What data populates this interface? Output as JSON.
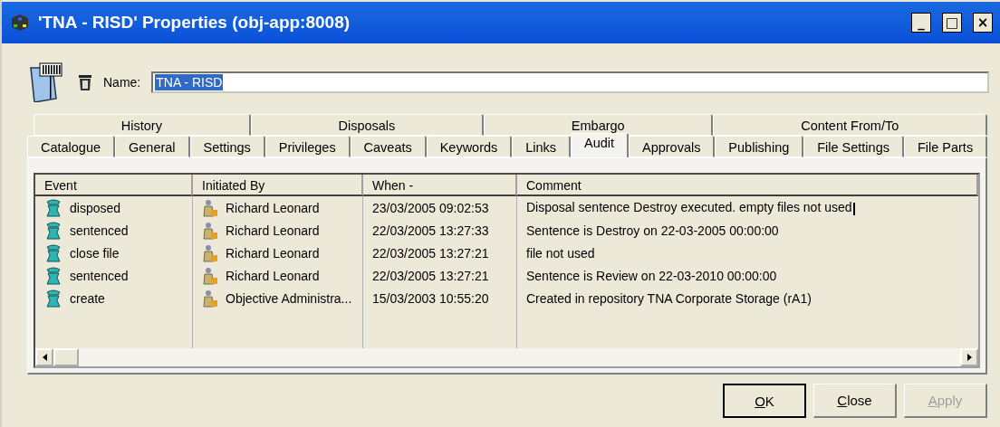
{
  "window": {
    "title": "'TNA - RISD' Properties (obj-app:8008)",
    "controls": [
      "_",
      "□",
      "×"
    ]
  },
  "name_field": {
    "label": "Name:",
    "value": "TNA - RISD",
    "text_selected": true
  },
  "tab_rows": [
    {
      "tabs": [
        {
          "label": "History",
          "selected": false
        },
        {
          "label": "Disposals",
          "selected": false
        },
        {
          "label": "Embargo",
          "selected": false
        },
        {
          "label": "Content From/To",
          "selected": false
        }
      ]
    },
    {
      "tabs": [
        {
          "label": "Catalogue",
          "selected": false
        },
        {
          "label": "General",
          "selected": false
        },
        {
          "label": "Settings",
          "selected": false
        },
        {
          "label": "Privileges",
          "selected": false
        },
        {
          "label": "Caveats",
          "selected": false
        },
        {
          "label": "Keywords",
          "selected": false
        },
        {
          "label": "Links",
          "selected": false
        },
        {
          "label": "Audit",
          "selected": true
        },
        {
          "label": "Approvals",
          "selected": false
        },
        {
          "label": "Publishing",
          "selected": false
        },
        {
          "label": "File Settings",
          "selected": false
        },
        {
          "label": "File Parts",
          "selected": false
        }
      ]
    }
  ],
  "table": {
    "columns": [
      "Event",
      "Initiated By",
      "When -",
      "Comment"
    ],
    "rows": [
      {
        "event": "disposed",
        "initiated_by": "Richard Leonard",
        "when": "23/03/2005 09:02:53",
        "comment": "Disposal sentence Destroy executed. empty files not used",
        "editing": true
      },
      {
        "event": "sentenced",
        "initiated_by": "Richard Leonard",
        "when": "22/03/2005 13:27:33",
        "comment": "Sentence is Destroy on 22-03-2005 00:00:00",
        "editing": false
      },
      {
        "event": "close file",
        "initiated_by": "Richard Leonard",
        "when": "22/03/2005 13:27:21",
        "comment": "file not used",
        "editing": false
      },
      {
        "event": "sentenced",
        "initiated_by": "Richard Leonard",
        "when": "22/03/2005 13:27:21",
        "comment": "Sentence is Review on 22-03-2010 00:00:00",
        "editing": false
      },
      {
        "event": "create",
        "initiated_by": "Objective Administra...",
        "when": "15/03/2003 10:55:20",
        "comment": "Created in repository TNA Corporate Storage (rA1)",
        "editing": false
      }
    ]
  },
  "buttons": [
    {
      "label": "OK",
      "default": true,
      "disabled": false
    },
    {
      "label": "Close",
      "default": false,
      "disabled": false
    },
    {
      "label": "Apply",
      "default": false,
      "disabled": true
    }
  ]
}
